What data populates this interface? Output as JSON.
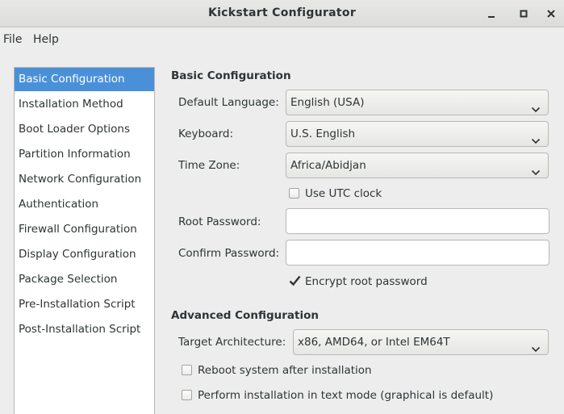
{
  "window": {
    "title": "Kickstart Configurator",
    "minimize_icon": "minimize-icon",
    "maximize_icon": "maximize-icon",
    "close_icon": "close-icon"
  },
  "menu": [
    "File",
    "Help"
  ],
  "sidebar": {
    "selected": "Basic Configuration",
    "items": [
      "Basic Configuration",
      "Installation Method",
      "Boot Loader Options",
      "Partition Information",
      "Network Configuration",
      "Authentication",
      "Firewall Configuration",
      "Display Configuration",
      "Package Selection",
      "Pre-Installation Script",
      "Post-Installation Script"
    ]
  },
  "basic": {
    "section_title": "Basic Configuration",
    "default_language": {
      "label": "Default Language:",
      "value": "English (USA)"
    },
    "keyboard": {
      "label": "Keyboard:",
      "value": "U.S. English"
    },
    "time_zone": {
      "label": "Time Zone:",
      "value": "Africa/Abidjan"
    },
    "utc_clock": {
      "label": "Use UTC clock",
      "checked": false
    },
    "root_password": {
      "label": "Root Password:",
      "value": ""
    },
    "confirm_password": {
      "label": "Confirm Password:",
      "value": ""
    },
    "encrypt_root": {
      "label": "Encrypt root password",
      "checked": true
    }
  },
  "advanced": {
    "section_title": "Advanced Configuration",
    "target_arch": {
      "label": "Target Architecture:",
      "value": "x86, AMD64, or Intel EM64T"
    },
    "reboot": {
      "label": "Reboot system after installation",
      "checked": false
    },
    "text_mode": {
      "label": "Perform installation in text mode (graphical is default)",
      "checked": false
    }
  },
  "colors": {
    "selection": "#4a90d9",
    "background": "#ededed"
  }
}
